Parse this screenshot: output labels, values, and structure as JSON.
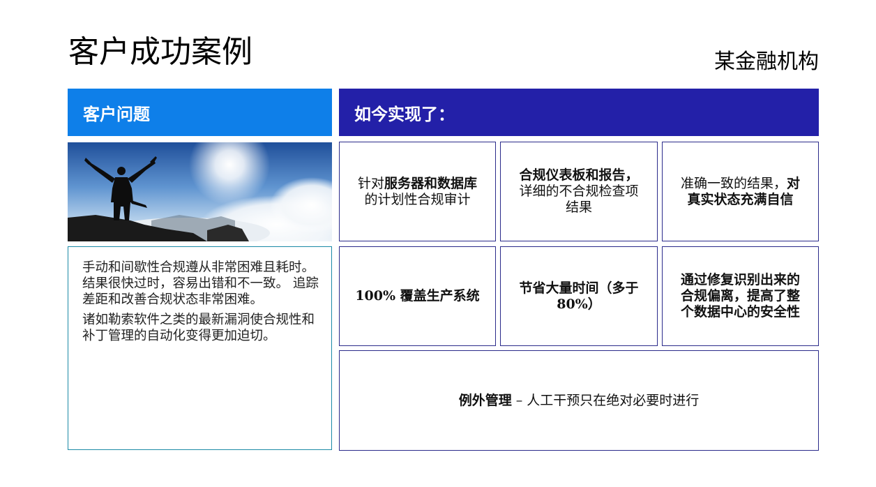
{
  "title": "客户成功案例",
  "organization": "某金融机构",
  "problem_header": "客户问题",
  "achieved_header": "如今实现了：",
  "photo": {
    "subject": "person-arms-raised-on-mountain-icon"
  },
  "problem": {
    "paragraph_1": "手动和间歇性合规遵从非常困难且耗时。 结果很快过时，容易出错和不一致。 追踪差距和改善合规状态非常困难。",
    "paragraph_2": "诸如勒索软件之类的最新漏洞使合规性和补丁管理的自动化变得更加迫切。"
  },
  "achievements": {
    "cell_1": {
      "prefix": "针对",
      "bold": "服务器和数据库",
      "suffix": "的计划性合规审计"
    },
    "cell_2": {
      "bold": "合规仪表板和报告，",
      "suffix": "详细的不合规检查项结果"
    },
    "cell_3": {
      "prefix": "准确一致的结果，",
      "bold": "对真实状态充满自信"
    },
    "cell_4": "100% 覆盖生产系统",
    "cell_5": "节省大量时间（多于80%）",
    "cell_6": "通过修复识别出来的合规偏离，提高了整个数据中心的安全性",
    "cell_7": {
      "bold": "例外管理",
      "suffix": " – 人工干预只在绝对必要时进行"
    }
  },
  "colors": {
    "problem_header_bg": "#0e7fe9",
    "achieved_header_bg": "#2320a8",
    "problem_border": "#1b8aa6",
    "cell_border": "#2a2a8a"
  }
}
